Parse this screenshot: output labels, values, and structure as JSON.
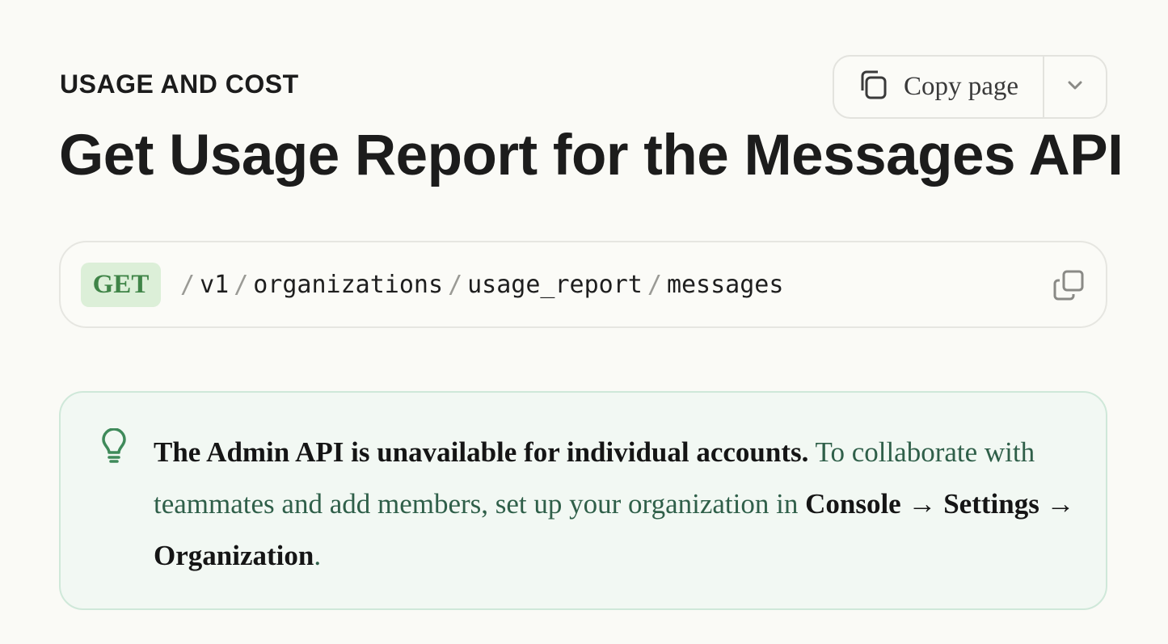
{
  "header": {
    "eyebrow": "USAGE AND COST",
    "title": "Get Usage Report for the Messages API",
    "copy_page_label": "Copy page"
  },
  "endpoint": {
    "method": "GET",
    "segments": [
      "v1",
      "organizations",
      "usage_report",
      "messages"
    ],
    "separator": "/"
  },
  "callout": {
    "bold_lead": "The Admin API is unavailable for individual accounts.",
    "text_1": " To collaborate with teammates and add members, set up your organization in ",
    "bold_path": "Console → Settings → Organization",
    "text_end": "."
  },
  "colors": {
    "accent_green": "#3f8447",
    "method_bg": "#dcefd8",
    "callout_bg": "#f2f8f3",
    "callout_border": "#cfe8d9",
    "callout_text": "#2f5f49"
  },
  "icons": {
    "copy_page": "copy-icon",
    "dropdown": "chevron-down-icon",
    "endpoint_copy": "copy-icon",
    "callout": "lightbulb-icon"
  }
}
